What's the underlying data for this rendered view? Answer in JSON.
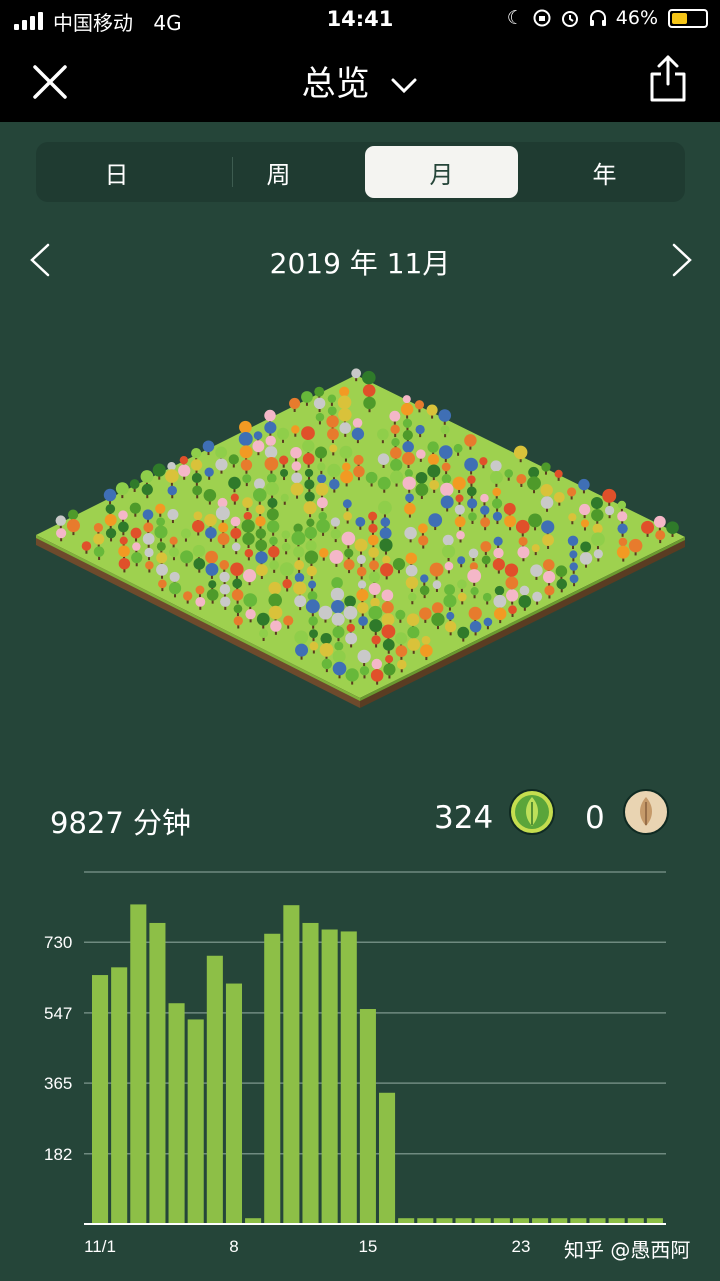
{
  "status_bar": {
    "carrier": "中国移动",
    "network": "4G",
    "time": "14:41",
    "battery": "46%",
    "battery_level": 0.46
  },
  "nav": {
    "title": "总览",
    "close_icon": "close-icon",
    "dropdown_icon": "chevron-down-icon",
    "share_icon": "share-icon"
  },
  "tabs": [
    {
      "label": "日",
      "active": false
    },
    {
      "label": "周",
      "active": false
    },
    {
      "label": "月",
      "active": true
    },
    {
      "label": "年",
      "active": false
    }
  ],
  "period": {
    "label": "2019 年 11月"
  },
  "summary": {
    "minutes": "9827 分钟",
    "trees": "324",
    "dead_trees": "0"
  },
  "colors": {
    "background": "#254539",
    "bar": "#8dbf47",
    "tree_badge": "#c5de4f",
    "dead_badge": "#e9d4b2"
  },
  "chart_data": {
    "type": "bar",
    "categories": [
      "1",
      "2",
      "3",
      "4",
      "5",
      "6",
      "7",
      "8",
      "9",
      "10",
      "11",
      "12",
      "13",
      "14",
      "15",
      "16",
      "17",
      "18",
      "19",
      "20",
      "21",
      "22",
      "23",
      "24",
      "25",
      "26",
      "27",
      "28",
      "29",
      "30"
    ],
    "values": [
      645,
      665,
      828,
      780,
      572,
      530,
      695,
      623,
      15,
      752,
      826,
      780,
      763,
      758,
      557,
      340,
      15,
      15,
      15,
      15,
      15,
      15,
      15,
      15,
      15,
      15,
      15,
      15,
      15,
      15
    ],
    "x_tick_labels": [
      "11/1",
      "8",
      "15",
      "23"
    ],
    "x_tick_days": [
      1,
      8,
      15,
      23
    ],
    "y_tick_labels": [
      "182",
      "365",
      "547",
      "730"
    ],
    "y_ticks": [
      182,
      365,
      547,
      730
    ],
    "ylim": [
      0,
      912
    ],
    "grid": true
  },
  "watermark": "知乎 @愚西阿"
}
